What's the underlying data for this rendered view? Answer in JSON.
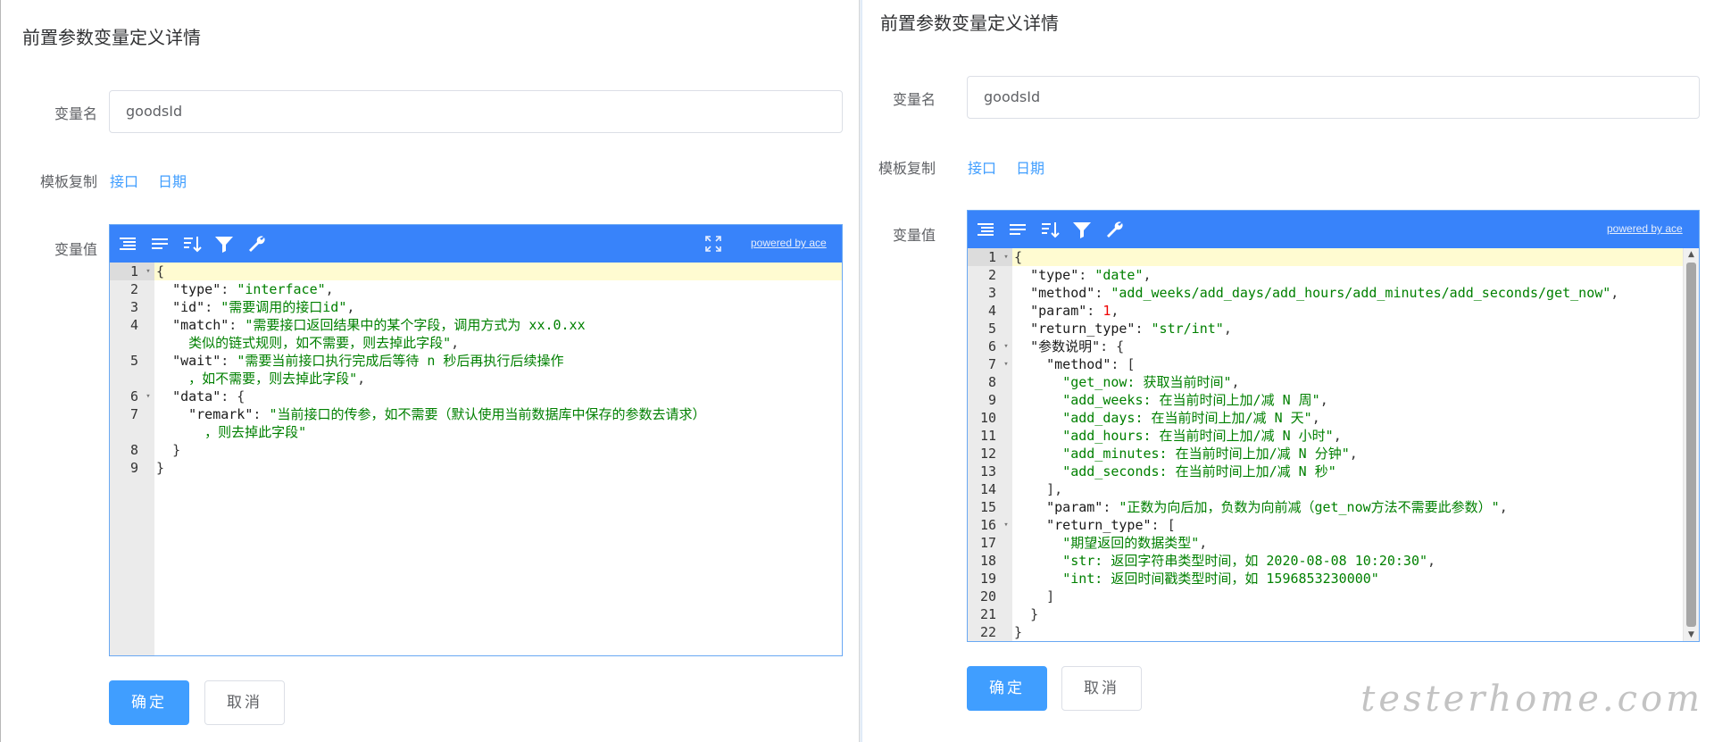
{
  "left": {
    "title": "前置参数变量定义详情",
    "form": {
      "var_name_label": "变量名",
      "var_name_value": "goodsId",
      "template_label": "模板复制",
      "template_links": [
        "接口",
        "日期"
      ],
      "var_value_label": "变量值"
    },
    "editor": {
      "powered_by": "powered by ace",
      "lines": [
        {
          "num": "1",
          "fold": "▾",
          "html": "<span class=\"p\">{</span>"
        },
        {
          "num": "2",
          "html": "  <span class=\"k\">\"type\"</span><span class=\"p\">: </span><span class=\"s\">\"interface\"</span><span class=\"p\">,</span>"
        },
        {
          "num": "3",
          "html": "  <span class=\"k\">\"id\"</span><span class=\"p\">: </span><span class=\"s\">\"需要调用的接口id\"</span><span class=\"p\">,</span>"
        },
        {
          "num": "4",
          "html": "  <span class=\"k\">\"match\"</span><span class=\"p\">: </span><span class=\"s\">\"需要接口返回结果中的某个字段，调用方式为 xx.0.xx</span>"
        },
        {
          "num": "",
          "html": "<span class=\"s\">    类似的链式规则，如不需要，则去掉此字段\"</span><span class=\"p\">,</span>"
        },
        {
          "num": "5",
          "html": "  <span class=\"k\">\"wait\"</span><span class=\"p\">: </span><span class=\"s\">\"需要当前接口执行完成后等待 n 秒后再执行后续操作</span>"
        },
        {
          "num": "",
          "html": "<span class=\"s\">    ，如不需要，则去掉此字段\"</span><span class=\"p\">,</span>"
        },
        {
          "num": "6",
          "fold": "▾",
          "html": "  <span class=\"k\">\"data\"</span><span class=\"p\">: {</span>"
        },
        {
          "num": "7",
          "html": "    <span class=\"k\">\"remark\"</span><span class=\"p\">: </span><span class=\"s\">\"当前接口的传参，如不需要（默认使用当前数据库中保存的参数去请求）</span>"
        },
        {
          "num": "",
          "html": "<span class=\"s\">      ，则去掉此字段\"</span>"
        },
        {
          "num": "8",
          "html": "  <span class=\"p\">}</span>"
        },
        {
          "num": "9",
          "html": "<span class=\"p\">}</span>"
        }
      ]
    },
    "buttons": {
      "confirm": "确定",
      "cancel": "取消"
    }
  },
  "right": {
    "title": "前置参数变量定义详情",
    "form": {
      "var_name_label": "变量名",
      "var_name_value": "goodsId",
      "template_label": "模板复制",
      "template_links": [
        "接口",
        "日期"
      ],
      "var_value_label": "变量值"
    },
    "editor": {
      "powered_by": "powered by ace",
      "lines": [
        {
          "num": "1",
          "fold": "▾",
          "html": "<span class=\"p\">{</span>"
        },
        {
          "num": "2",
          "html": "  <span class=\"k\">\"type\"</span><span class=\"p\">: </span><span class=\"s\">\"date\"</span><span class=\"p\">,</span>"
        },
        {
          "num": "3",
          "html": "  <span class=\"k\">\"method\"</span><span class=\"p\">: </span><span class=\"s\">\"add_weeks/add_days/add_hours/add_minutes/add_seconds/get_now\"</span><span class=\"p\">,</span>"
        },
        {
          "num": "4",
          "html": "  <span class=\"k\">\"param\"</span><span class=\"p\">: </span><span class=\"n\">1</span><span class=\"p\">,</span>"
        },
        {
          "num": "5",
          "html": "  <span class=\"k\">\"return_type\"</span><span class=\"p\">: </span><span class=\"s\">\"str/int\"</span><span class=\"p\">,</span>"
        },
        {
          "num": "6",
          "fold": "▾",
          "html": "  <span class=\"k\">\"参数说明\"</span><span class=\"p\">: {</span>"
        },
        {
          "num": "7",
          "fold": "▾",
          "html": "    <span class=\"k\">\"method\"</span><span class=\"p\">: [</span>"
        },
        {
          "num": "8",
          "html": "      <span class=\"s\">\"get_now: 获取当前时间\"</span><span class=\"p\">,</span>"
        },
        {
          "num": "9",
          "html": "      <span class=\"s\">\"add_weeks: 在当前时间上加/减 N 周\"</span><span class=\"p\">,</span>"
        },
        {
          "num": "10",
          "html": "      <span class=\"s\">\"add_days: 在当前时间上加/减 N 天\"</span><span class=\"p\">,</span>"
        },
        {
          "num": "11",
          "html": "      <span class=\"s\">\"add_hours: 在当前时间上加/减 N 小时\"</span><span class=\"p\">,</span>"
        },
        {
          "num": "12",
          "html": "      <span class=\"s\">\"add_minutes: 在当前时间上加/减 N 分钟\"</span><span class=\"p\">,</span>"
        },
        {
          "num": "13",
          "html": "      <span class=\"s\">\"add_seconds: 在当前时间上加/减 N 秒\"</span>"
        },
        {
          "num": "14",
          "html": "    <span class=\"p\">],</span>"
        },
        {
          "num": "15",
          "html": "    <span class=\"k\">\"param\"</span><span class=\"p\">: </span><span class=\"s\">\"正数为向后加，负数为向前减（get_now方法不需要此参数）\"</span><span class=\"p\">,</span>"
        },
        {
          "num": "16",
          "fold": "▾",
          "html": "    <span class=\"k\">\"return_type\"</span><span class=\"p\">: [</span>"
        },
        {
          "num": "17",
          "html": "      <span class=\"s\">\"期望返回的数据类型\"</span><span class=\"p\">,</span>"
        },
        {
          "num": "18",
          "html": "      <span class=\"s\">\"str: 返回字符串类型时间，如 2020-08-08 10:20:30\"</span><span class=\"p\">,</span>"
        },
        {
          "num": "19",
          "html": "      <span class=\"s\">\"int: 返回时间戳类型时间，如 1596853230000\"</span>"
        },
        {
          "num": "20",
          "html": "    <span class=\"p\">]</span>"
        },
        {
          "num": "21",
          "html": "  <span class=\"p\">}</span>"
        },
        {
          "num": "22",
          "html": "<span class=\"p\">}</span>"
        }
      ]
    },
    "buttons": {
      "confirm": "确定",
      "cancel": "取消"
    }
  },
  "watermark": "testerhome.com",
  "colors": {
    "primary": "#409eff",
    "ace_toolbar": "#3883fa",
    "string": "#008000",
    "number": "#ee0000"
  }
}
